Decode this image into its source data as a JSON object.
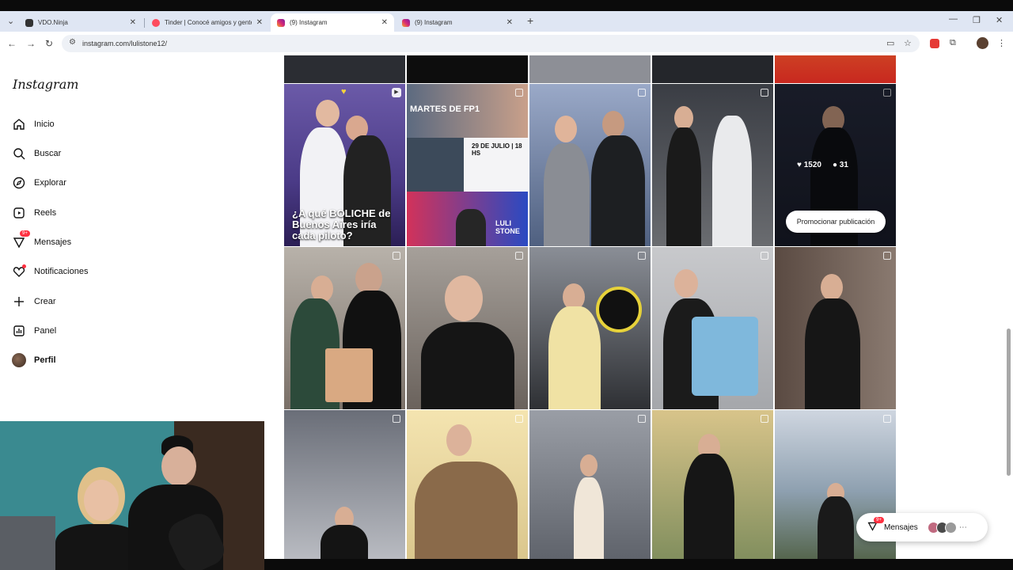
{
  "browser": {
    "tabs": [
      {
        "title": "VDO.Ninja",
        "color": "#333333"
      },
      {
        "title": "Tinder | Conocé amigos y gente n",
        "color": "#fd4b5e"
      },
      {
        "title": "(9) Instagram",
        "color": "#d62976"
      },
      {
        "title": "(9) Instagram",
        "color": "#d62976"
      }
    ],
    "url": "instagram.com/lulistone12/"
  },
  "sidebar": {
    "logo": "Instagram",
    "items": [
      {
        "label": "Inicio",
        "icon": "home-icon"
      },
      {
        "label": "Buscar",
        "icon": "search-icon"
      },
      {
        "label": "Explorar",
        "icon": "compass-icon"
      },
      {
        "label": "Reels",
        "icon": "reels-icon"
      },
      {
        "label": "Mensajes",
        "icon": "messenger-icon",
        "badge": "9+"
      },
      {
        "label": "Notificaciones",
        "icon": "heart-icon"
      },
      {
        "label": "Crear",
        "icon": "plus-icon"
      },
      {
        "label": "Panel",
        "icon": "chart-icon"
      },
      {
        "label": "Perfil",
        "icon": "avatar"
      }
    ]
  },
  "posts": {
    "boliche_caption": "¿A qué BOLICHE de Buenos Aires iría cada piloto?",
    "fp1_title": "MARTES DE FP1",
    "fp1_date": "29 DE JULIO | 18 HS",
    "fp1_name": "LULI STONE",
    "hover_likes": "1520",
    "hover_comments": "31",
    "promo_button": "Promocionar publicación"
  },
  "messages_pill": {
    "label": "Mensajes",
    "badge": "9+"
  }
}
